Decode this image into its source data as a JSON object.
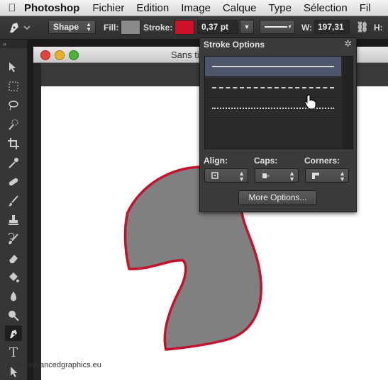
{
  "menubar": {
    "app_name": "Photoshop",
    "items": [
      "Fichier",
      "Edition",
      "Image",
      "Calque",
      "Type",
      "Sélection",
      "Fil"
    ]
  },
  "options_bar": {
    "mode": "Shape",
    "fill_label": "Fill:",
    "stroke_label": "Stroke:",
    "stroke_width": "0,37 pt",
    "w_label": "W:",
    "w_value": "197,31",
    "h_label": "H:",
    "fill_color": "#8a8a8a",
    "stroke_color": "#d0112b"
  },
  "document": {
    "title": "Sans ti",
    "shape_fill": "#808080",
    "shape_stroke": "#c4122d"
  },
  "stroke_options": {
    "title": "Stroke Options",
    "align_label": "Align:",
    "caps_label": "Caps:",
    "corners_label": "Corners:",
    "more_options_label": "More Options..."
  },
  "watermark": "www.advancedgraphics.eu"
}
